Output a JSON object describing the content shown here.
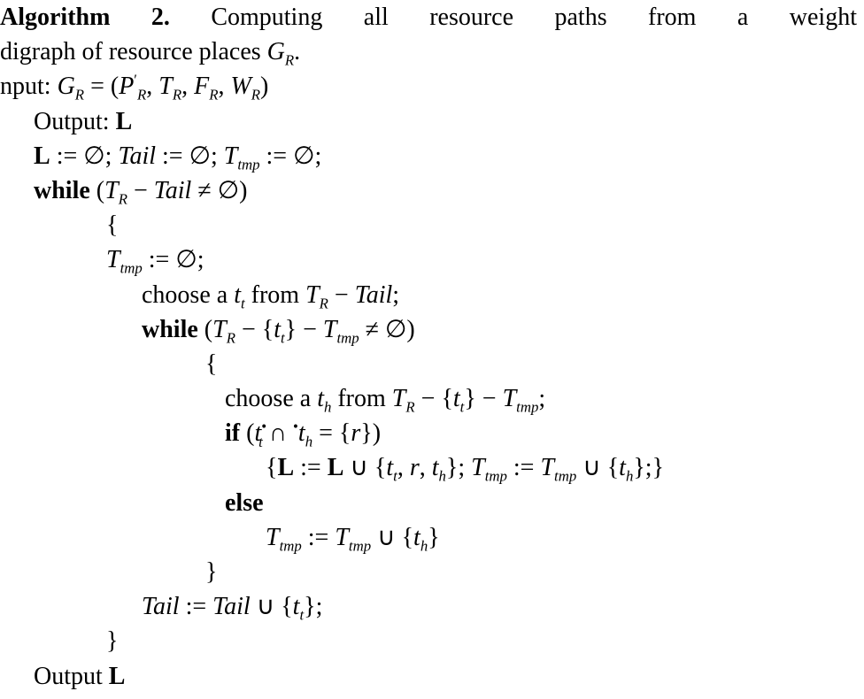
{
  "algo": {
    "title_prefix": "Algorithm 2.",
    "title_rest": " Computing all resource paths from a weight",
    "desc_line2": "digraph of resource places ",
    "GR": "G",
    "R_sub": "R",
    "input_label": "nput: ",
    "input_expr_parts": {
      "eq": " = (",
      "P": "P",
      "prime": "′",
      "comma_space": ", ",
      "T": "T",
      "F": "F",
      "W": "W",
      "close": ")"
    },
    "output_label": "Output: ",
    "L": "L",
    "init_line": {
      "assign": " := ",
      "empty": "∅",
      "semi_sp": "; ",
      "Tail": "Tail",
      "Ttmp": "T",
      "tmp_sub": "tmp"
    },
    "while_kw": "while",
    "cond_outer": {
      "open": " (",
      "minus": " − ",
      "Tail": "Tail",
      "neq": " ≠ ",
      "empty": "∅",
      "close": ")"
    },
    "brace_open": "{",
    "brace_close": "}",
    "ttmp_reset": {
      "assign": " := ",
      "empty": "∅",
      "semi": ";"
    },
    "choose_tt": {
      "pre": "choose a ",
      "t": "t",
      "t_sub": "t",
      "mid": " from ",
      "minus": " − ",
      "Tail": "Tail",
      "semi": ";"
    },
    "cond_inner": {
      "open": " (",
      "minus": " − ",
      "set_open": "{",
      "t": "t",
      "t_sub": "t",
      "set_close": "}",
      "neq": " ≠ ",
      "empty": "∅",
      "close": ")"
    },
    "choose_th": {
      "pre": "choose a ",
      "t": "t",
      "h_sub": "h",
      "mid": " from ",
      "minus": " − ",
      "set_open": "{",
      "t_sub": "t",
      "set_close": "}",
      "semi": ";"
    },
    "if_kw": "if",
    "if_cond": {
      "open": " (",
      "t": "t",
      "t_sub": "t",
      "sup_dot": "•",
      "cap": " ∩ ",
      "pre_dot": "•",
      "th": "t",
      "h_sub": "h",
      "eq": " = ",
      "set_open": "{",
      "r": "r",
      "set_close": "}",
      "close": ")"
    },
    "if_body": {
      "open": "{",
      "assign": " := ",
      "cup": " ∪ ",
      "set_open": "{",
      "t": "t",
      "t_sub": "t",
      "comma": ", ",
      "r": "r",
      "h_sub": "h",
      "set_close": "}",
      "semi_sp": "; ",
      "Ttmp": "T",
      "tmp_sub": "tmp",
      "semi": ";",
      "close": "}"
    },
    "else_kw": "else",
    "else_body": {
      "Ttmp": "T",
      "tmp_sub": "tmp",
      "assign": " := ",
      "cup": " ∪ ",
      "set_open": "{",
      "t": "t",
      "h_sub": "h",
      "set_close": "}"
    },
    "tail_update": {
      "Tail": "Tail",
      "assign": " := ",
      "cup": " ∪ ",
      "set_open": "{",
      "t": "t",
      "t_sub": "t",
      "set_close": "}",
      "semi": ";"
    },
    "output_final": "Output "
  }
}
